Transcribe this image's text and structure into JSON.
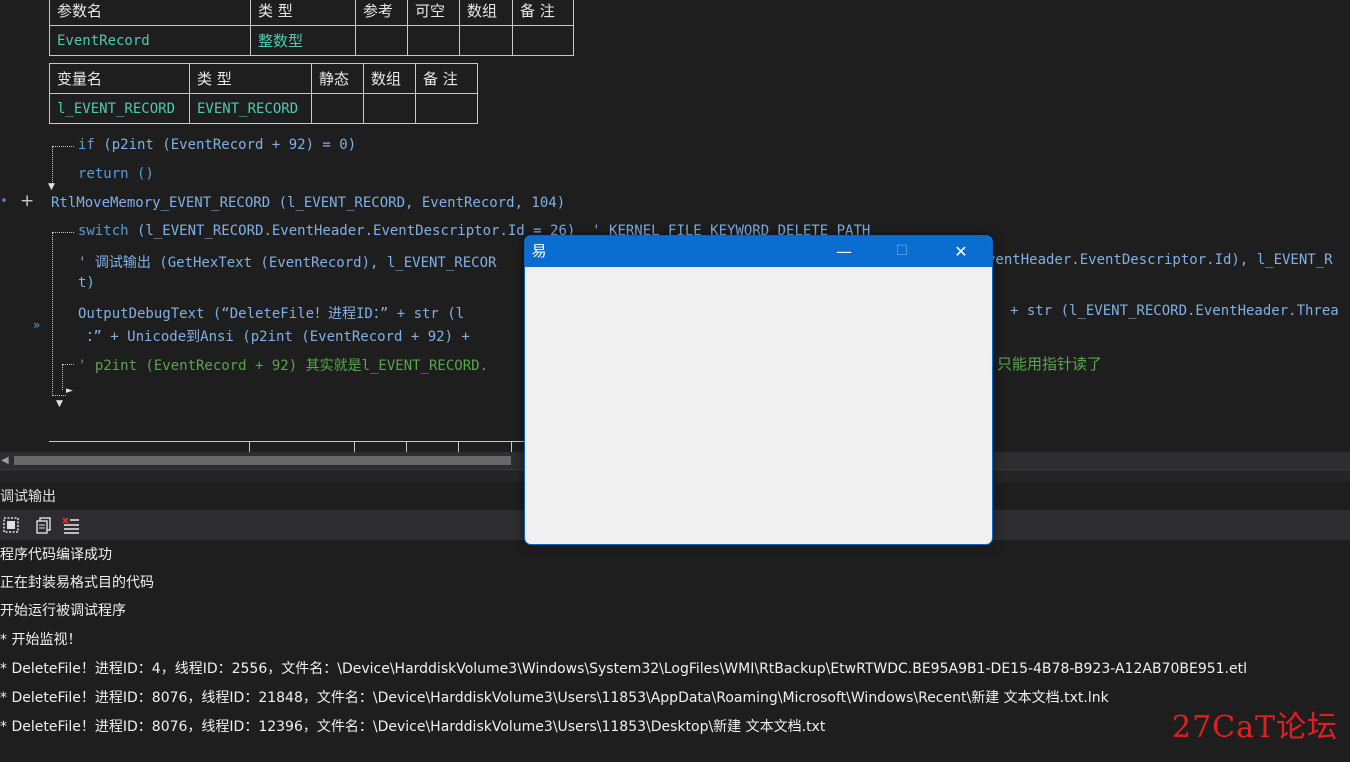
{
  "params_table": {
    "headers": [
      "参数名",
      "类 型",
      "参考",
      "可空",
      "数组",
      "备 注"
    ],
    "row": [
      "EventRecord",
      "整数型",
      "",
      "",
      "",
      ""
    ]
  },
  "vars_table": {
    "headers": [
      "变量名",
      "类 型",
      "静态",
      "数组",
      "备 注"
    ],
    "row": [
      "l_EVENT_RECORD",
      "EVENT_RECORD",
      "",
      "",
      ""
    ]
  },
  "code": {
    "l1_kw": "if",
    "l1_rest": " (p2int (EventRecord + 92) = 0)",
    "l2": "return ()",
    "l3_marker": "+",
    "l3": "RtlMoveMemory_EVENT_RECORD (l_EVENT_RECORD, EventRecord, 104)",
    "l4_kw": "switch",
    "l4_rest": " (l_EVENT_RECORD.EventHeader.EventDescriptor.Id = 26)  ' KERNEL_FILE_KEYWORD_DELETE_PATH",
    "l5a": "' 调试输出 (GetHexText (EventRecord), l_EVENT_RECOR",
    "l5b": "ventHeader.EventDescriptor.Id), l_EVENT_R",
    "l6": "t)",
    "l7a": "OutputDebugText (“DeleteFile！进程ID：” + str (l",
    "l7b": "+ str (l_EVENT_RECORD.EventHeader.Threa",
    "l7_marker": "»",
    "l8": " ：” + Unicode到Ansi (p2int (EventRecord + 92) +",
    "l9a": "' p2int (EventRecord + 92) 其实就是l_EVENT_RECORD.",
    "l9b": "只能用指针读了"
  },
  "panel": {
    "title": "调试输出"
  },
  "output_lines": [
    "程序代码编译成功",
    "正在封装易格式目的代码",
    "开始运行被调试程序",
    "* 开始监视！",
    "* DeleteFile！进程ID：4，线程ID：2556，文件名：\\Device\\HarddiskVolume3\\Windows\\System32\\LogFiles\\WMI\\RtBackup\\EtwRTWDC.BE95A9B1-DE15-4B78-B923-A12AB70BE951.etl",
    "* DeleteFile！进程ID：8076，线程ID：21848，文件名：\\Device\\HarddiskVolume3\\Users\\11853\\AppData\\Roaming\\Microsoft\\Windows\\Recent\\新建 文本文档.txt.lnk",
    "* DeleteFile！进程ID：8076，线程ID：12396，文件名：\\Device\\HarddiskVolume3\\Users\\11853\\Desktop\\新建 文本文档.txt"
  ],
  "watermark": "27CaT论坛",
  "dialog": {
    "app_icon": "易",
    "minimize": "—",
    "maximize": "☐",
    "close": "✕"
  },
  "icons": {
    "toolbar": [
      "select-all-icon",
      "copy-icon",
      "clear-list-icon"
    ],
    "dialog": [
      "app-logo-icon",
      "minimize-icon",
      "maximize-icon",
      "close-icon"
    ]
  },
  "colors": {
    "keyword": "#569cd6",
    "identifier": "#7fb0e6",
    "comment": "#57a64a",
    "type_cell": "#4ec9b0",
    "titlebar": "#0a6ed1",
    "watermark": "#e02020"
  }
}
